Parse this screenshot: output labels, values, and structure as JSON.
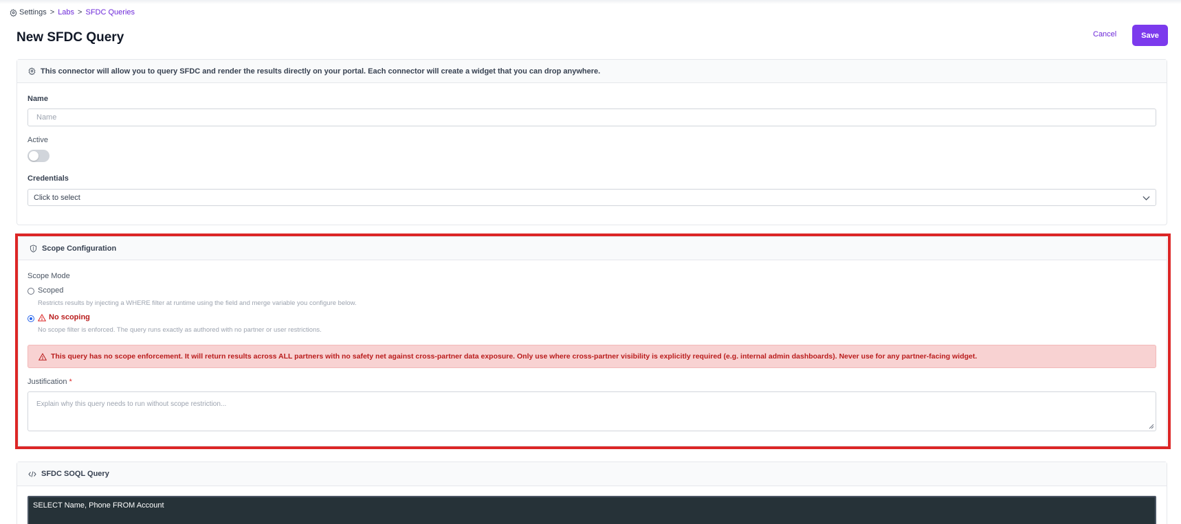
{
  "breadcrumb": {
    "root": "Settings",
    "sep1": ">",
    "labs": "Labs",
    "sep2": ">",
    "current": "SFDC Queries"
  },
  "page": {
    "title": "New SFDC Query"
  },
  "actions": {
    "cancel": "Cancel",
    "save": "Save"
  },
  "intro": {
    "text": "This connector will allow you to query SFDC and render the results directly on your portal. Each connector will create a widget that you can drop anywhere."
  },
  "form": {
    "name_label": "Name",
    "name_placeholder": "Name",
    "active_label": "Active",
    "active_value": false,
    "credentials_label": "Credentials",
    "credentials_value": "Click to select"
  },
  "scope": {
    "title": "Scope Configuration",
    "mode_label": "Scope Mode",
    "options": [
      {
        "label": "Scoped",
        "help": "Restricts results by injecting a WHERE filter at runtime using the field and merge variable you configure below.",
        "selected": false
      },
      {
        "label": "No scoping",
        "help": "No scope filter is enforced. The query runs exactly as authored with no partner or user restrictions.",
        "selected": true
      }
    ],
    "warning": "This query has no scope enforcement. It will return results across ALL partners with no safety net against cross-partner data exposure. Only use where cross-partner visibility is explicitly required (e.g. internal admin dashboards). Never use for any partner-facing widget.",
    "justification_label": "Justification",
    "justification_required": "*",
    "justification_placeholder": "Explain why this query needs to run without scope restriction..."
  },
  "soql": {
    "title": "SFDC SOQL Query",
    "query": "SELECT Name, Phone FROM Account"
  },
  "colors": {
    "accent": "#7c3aed",
    "danger": "#dc2626",
    "alert_bg": "#f8d2d2",
    "code_bg": "#263238"
  }
}
